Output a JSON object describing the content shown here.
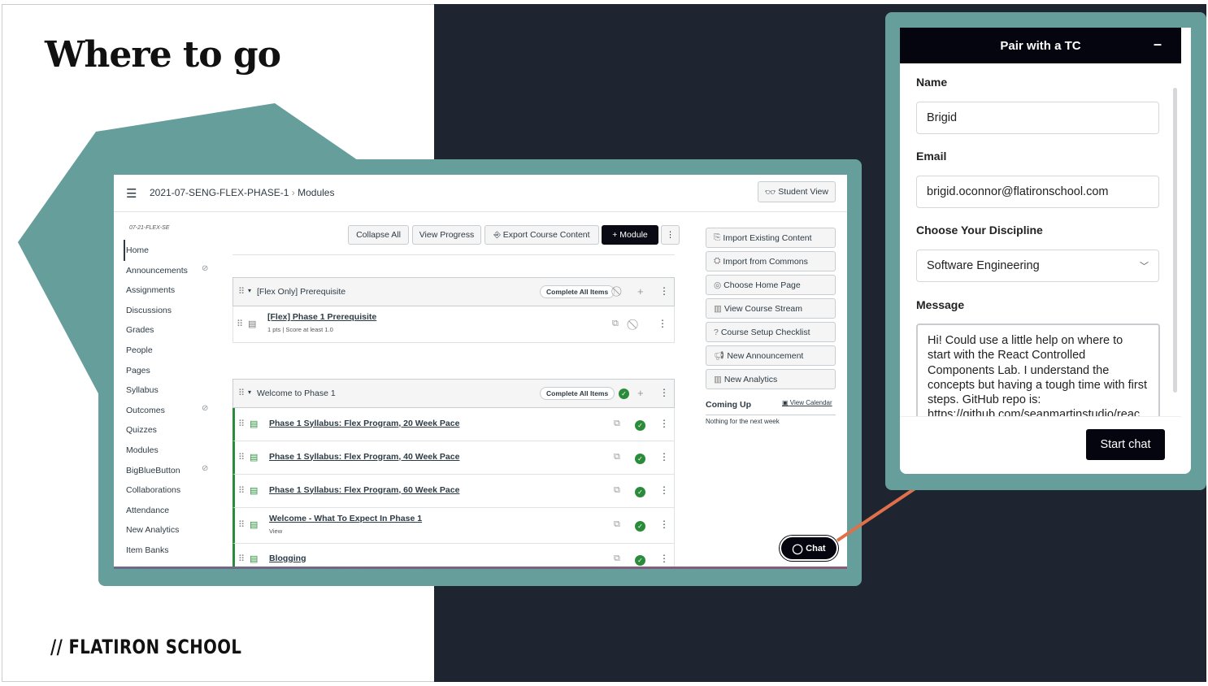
{
  "slide": {
    "title": "Where to go",
    "logo_text": "// FLATIRON SCHOOL",
    "colors": {
      "teal": "#669e9b",
      "navy": "#1f2530",
      "arrow": "#e0704a"
    }
  },
  "canvas": {
    "breadcrumb": {
      "course": "2021-07-SENG-FLEX-PHASE-1",
      "separator": "›",
      "page": "Modules"
    },
    "student_view": "Student View",
    "course_code": "07-21-FLEX-SE",
    "sidebar": [
      {
        "label": "Home",
        "active": true
      },
      {
        "label": "Announcements",
        "hidden": true
      },
      {
        "label": "Assignments"
      },
      {
        "label": "Discussions"
      },
      {
        "label": "Grades"
      },
      {
        "label": "People"
      },
      {
        "label": "Pages"
      },
      {
        "label": "Syllabus"
      },
      {
        "label": "Outcomes",
        "hidden": true
      },
      {
        "label": "Quizzes"
      },
      {
        "label": "Modules"
      },
      {
        "label": "BigBlueButton",
        "hidden": true
      },
      {
        "label": "Collaborations"
      },
      {
        "label": "Attendance"
      },
      {
        "label": "New Analytics"
      },
      {
        "label": "Item Banks"
      }
    ],
    "toolbar": {
      "collapse_all": "Collapse All",
      "view_progress": "View Progress",
      "export": "Export Course Content",
      "add_module": "+ Module"
    },
    "modules": [
      {
        "title": "[Flex Only] Prerequisite",
        "complete_label": "Complete All Items",
        "items": [
          {
            "title": "[Flex] Phase 1 Prerequisite",
            "meta": "1 pts  |  Score at least 1.0"
          }
        ]
      },
      {
        "title": "Welcome to Phase 1",
        "complete_label": "Complete All Items",
        "items": [
          {
            "title": "Phase 1 Syllabus: Flex Program, 20 Week Pace"
          },
          {
            "title": "Phase 1 Syllabus: Flex Program, 40 Week Pace"
          },
          {
            "title": "Phase 1 Syllabus: Flex Program, 60 Week Pace"
          },
          {
            "title": "Welcome - What To Expect In Phase 1",
            "meta": "View"
          },
          {
            "title": "Blogging"
          }
        ]
      }
    ],
    "right_buttons": [
      "Import Existing Content",
      "Import from Commons",
      "Choose Home Page",
      "View Course Stream",
      "Course Setup Checklist",
      "New Announcement",
      "New Analytics"
    ],
    "coming_up": {
      "title": "Coming Up",
      "view_calendar": "View Calendar",
      "empty": "Nothing for the next week"
    },
    "chat_button": "Chat"
  },
  "tc_form": {
    "title": "Pair with a TC",
    "minimize": "–",
    "name_label": "Name",
    "name_value": "Brigid",
    "email_label": "Email",
    "email_value": "brigid.oconnor@flatironschool.com",
    "discipline_label": "Choose Your Discipline",
    "discipline_value": "Software Engineering",
    "message_label": "Message",
    "message_value": "Hi! Could use a little help on where to start with the React Controlled Components Lab. I understand the concepts but having a tough time with first steps. GitHub repo is: https://github.com/seanmartinstudio/reac",
    "submit": "Start chat"
  }
}
